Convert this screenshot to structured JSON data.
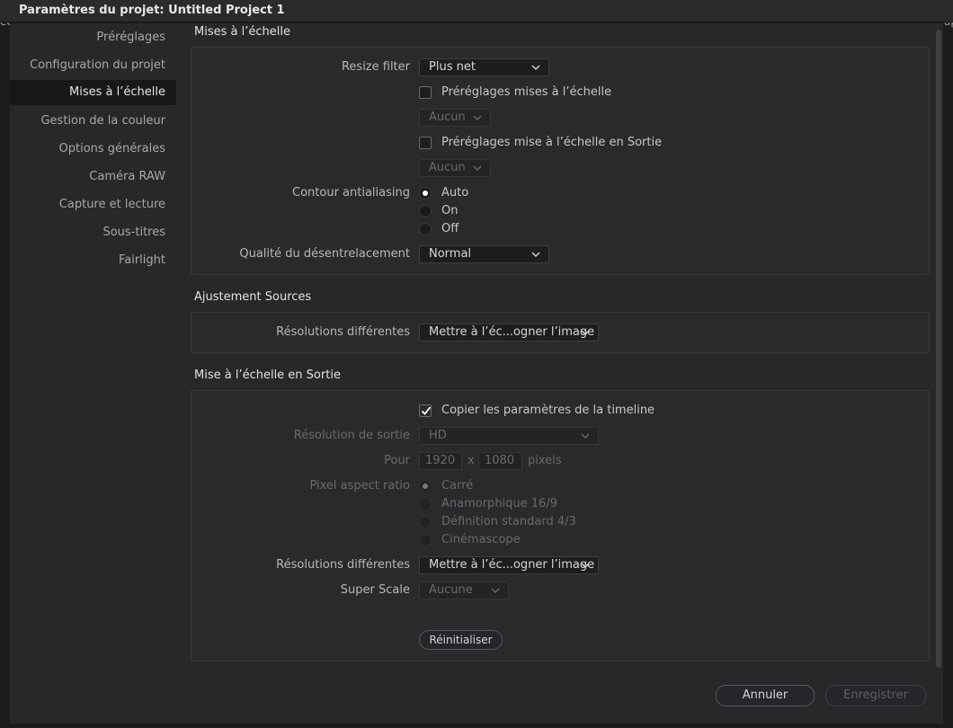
{
  "window": {
    "title": "Paramètres du projet:  Untitled Project 1",
    "bg_left_text": "éc",
    "bg_right_text": "ap"
  },
  "sidebar": {
    "items": [
      {
        "label": "Préréglages",
        "active": false
      },
      {
        "label": "Configuration du projet",
        "active": false
      },
      {
        "label": "Mises à l’échelle",
        "active": true
      },
      {
        "label": "Gestion de la couleur",
        "active": false
      },
      {
        "label": "Options générales",
        "active": false
      },
      {
        "label": "Caméra RAW",
        "active": false
      },
      {
        "label": "Capture et lecture",
        "active": false
      },
      {
        "label": "Sous-titres",
        "active": false
      },
      {
        "label": "Fairlight",
        "active": false
      }
    ]
  },
  "scaling": {
    "section_title": "Mises à l’échelle",
    "resize_filter_label": "Resize filter",
    "resize_filter_value": "Plus net",
    "preset_scaling_label": "Préréglages mises à l’échelle",
    "preset_scaling_checked": false,
    "preset_scaling_value": "Aucun",
    "preset_output_label": "Préréglages mise à l’échelle en Sortie",
    "preset_output_checked": false,
    "preset_output_value": "Aucun",
    "antialias_label": "Contour antialiasing",
    "antialias_options": [
      "Auto",
      "On",
      "Off"
    ],
    "antialias_selected": "Auto",
    "deinterlace_label": "Qualité du désentrelacement",
    "deinterlace_value": "Normal"
  },
  "sources": {
    "section_title": "Ajustement Sources",
    "mismatch_label": "Résolutions différentes",
    "mismatch_value": "Mettre à l’éc...ogner l’image"
  },
  "output": {
    "section_title": "Mise à l’échelle en Sortie",
    "copy_timeline_label": "Copier les paramètres de la timeline",
    "copy_timeline_checked": true,
    "resolution_label": "Résolution de sortie",
    "resolution_value": "HD",
    "for_label": "Pour",
    "width": "1920",
    "times": "x",
    "height": "1080",
    "pixels_unit": "pixels",
    "par_label": "Pixel aspect ratio",
    "par_options": [
      "Carré",
      "Anamorphique 16/9",
      "Définition standard 4/3",
      "Cinémascope"
    ],
    "par_selected": "Carré",
    "mismatch_label": "Résolutions différentes",
    "mismatch_value": "Mettre à l’éc...ogner l’image",
    "super_scale_label": "Super Scale",
    "super_scale_value": "Aucune",
    "reset_button": "Réinitialiser"
  },
  "footer": {
    "cancel_button": "Annuler",
    "save_button": "Enregistrer"
  }
}
